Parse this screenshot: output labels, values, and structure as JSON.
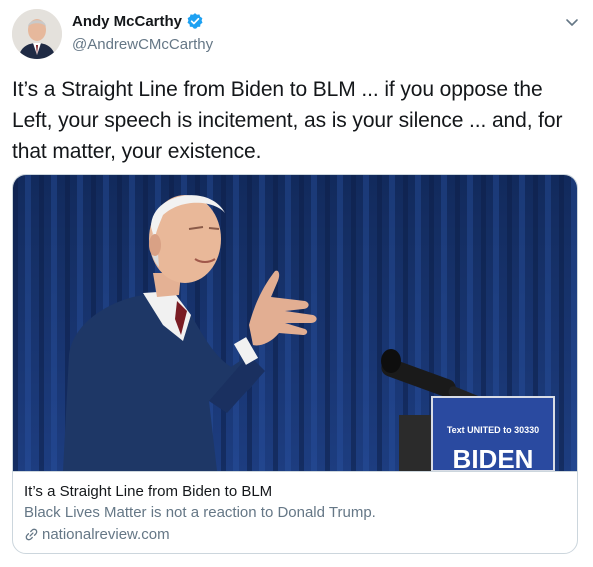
{
  "author": {
    "display_name": "Andy McCarthy",
    "handle": "@AndrewCMcCarthy",
    "verified": true
  },
  "tweet": {
    "text": "It’s a Straight Line from Biden to BLM ... if you oppose the Left, your speech is incitement, as is your silence ... and, for that matter, your existence."
  },
  "card": {
    "title": "It’s a Straight Line from Biden to BLM",
    "description": "Black Lives Matter is not a reaction to Donald Trump.",
    "domain": "nationalreview.com",
    "podium_sign_top": "Text UNITED to 30330",
    "podium_sign_main": "BIDEN"
  },
  "icons": {
    "verified": "verified-badge-icon",
    "menu": "chevron-down-icon",
    "link": "link-icon"
  },
  "colors": {
    "verified_blue": "#1da1f2",
    "secondary_text": "#657786",
    "border": "#ccd6dd",
    "curtain": "#1b3a78",
    "suit": "#1e3766",
    "sign": "#2a4aa0"
  }
}
